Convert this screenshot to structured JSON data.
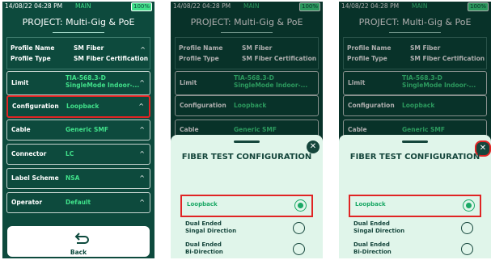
{
  "status": {
    "time": "14/08/22 04:28 PM",
    "mode": "MAIN",
    "battery": "100%"
  },
  "project_title": "PROJECT: Multi-Gig & PoE",
  "profile": {
    "name_label": "Profile Name",
    "name_value": "SM Fiber",
    "type_label": "Profile Type",
    "type_value": "SM Fiber Certification"
  },
  "rows": [
    {
      "label": "Limit",
      "value": "TIA-568.3-D SingleMode Indoor-..."
    },
    {
      "label": "Configuration",
      "value": "Loopback"
    },
    {
      "label": "Cable",
      "value": "Generic SMF"
    },
    {
      "label": "Connector",
      "value": "LC"
    },
    {
      "label": "Label Scheme",
      "value": "NSA"
    },
    {
      "label": "Operator",
      "value": "Default"
    }
  ],
  "back_label": "Back",
  "sheet": {
    "title": "FIBER TEST CONFIGURATION",
    "close": "✕",
    "options": [
      {
        "line1": "Loopback",
        "line2": ""
      },
      {
        "line1": "Dual Ended",
        "line2": "Singal Direction"
      },
      {
        "line1": "Dual Ended",
        "line2": "Bi-Direction"
      }
    ]
  },
  "icons": {
    "caret": "chevron-up-icon",
    "back": "back-arrow-icon",
    "close": "close-icon"
  },
  "colors": {
    "bg": "#0d4a3d",
    "accent": "#40e08a",
    "highlight": "#e02424",
    "sheet": "#e0f5ea"
  }
}
